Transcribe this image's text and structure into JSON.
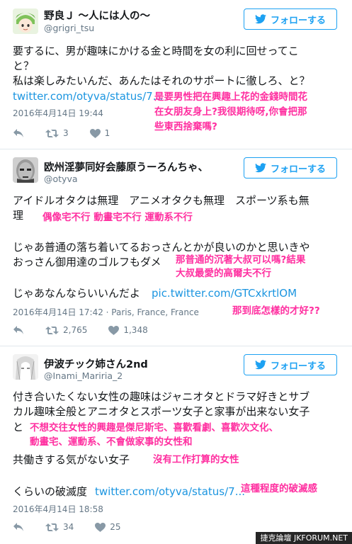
{
  "colors": {
    "accent": "#1da1f2",
    "link": "#1b95e0",
    "annotation": "#ff2fa0",
    "meta": "#657786"
  },
  "follow_label": "フォローする",
  "tweets": [
    {
      "name": "野良Ｊ ～人には人の～",
      "handle": "@grigri_tsu",
      "lines": [
        "要するに、男が趣味にかける金と時間を女の利に回せってこ",
        "と？",
        "私は楽しみたいんだ、あんたはそれのサポートに徹しろ、と？"
      ],
      "link": "twitter.com/otyva/status/7...",
      "timestamp": "2016年4月14日 19:44",
      "retweets": "3",
      "likes": "1",
      "annotation": [
        "是要男性把在興趣上花的金錢時間花",
        "在女朋友身上?我很期待呀,你會把那",
        "些東西捨棄嗎?"
      ]
    },
    {
      "name": "欧州淫夢同好会藤原うーろんちゃ、",
      "handle": "@otyva",
      "lines": [
        "アイドルオタクは無理　アニメオタクも無理　スポーツ系も無",
        "理",
        "じゃあ普通の落ち着いてるおっさんとかが良いのかと思いきや",
        "おっさん御用達のゴルフもダメ",
        "じゃあなんならいいんだよ"
      ],
      "link": "pic.twitter.com/GTCxkrtlOM",
      "timestamp": "2016年4月14日 17:42 · Paris, France, France",
      "retweets": "2,765",
      "likes": "1,348",
      "annotation_1": "偶像宅不行 動畫宅不行 運動系不行",
      "annotation_2": [
        "那普通的沉著大叔可以嗎?結果",
        "大叔最愛的高爾夫不行"
      ],
      "annotation_3": "那到底怎樣的才好??"
    },
    {
      "name": "伊波チック姉さん2nd",
      "handle": "@Inami_Mariria_2",
      "lines": [
        "付き合いたくない女性の趣味はジャニオタとドラマ好きとサブ",
        "カル趣味全般とアニオタとスポーツ女子と家事が出来ない女子",
        "と",
        "共働きする気がない女子",
        "くらいの破滅度"
      ],
      "link": "twitter.com/otyva/status/7...",
      "timestamp": "2016年4月14日 18:58",
      "retweets": "34",
      "likes": "25",
      "annotation_1": [
        "不想交往女性的興趣是傑尼斯宅、喜歡看劇、喜歡次文化、",
        "動畫宅、運動系、不會做家事的女性和"
      ],
      "annotation_2": "沒有工作打算的女性",
      "annotation_3": "這種程度的破滅感"
    }
  ],
  "watermark": "捷克論壇 JKFORUM.NET"
}
